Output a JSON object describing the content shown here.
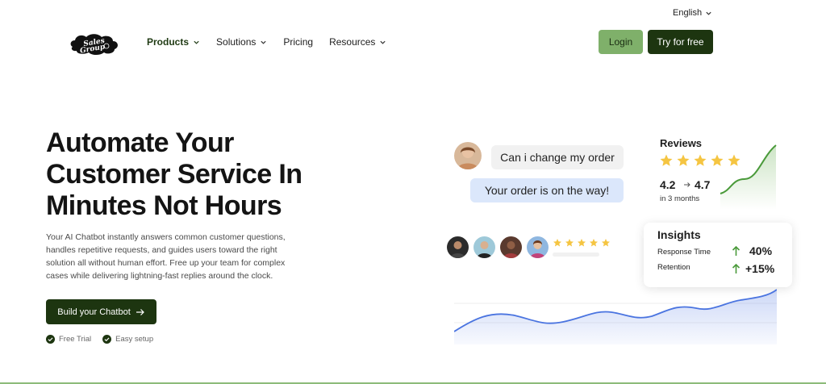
{
  "header": {
    "language": "English",
    "logo_text": "Sales Group",
    "nav": [
      {
        "label": "Products",
        "has_dropdown": true,
        "active": true
      },
      {
        "label": "Solutions",
        "has_dropdown": true,
        "active": false
      },
      {
        "label": "Pricing",
        "has_dropdown": false,
        "active": false
      },
      {
        "label": "Resources",
        "has_dropdown": true,
        "active": false
      }
    ],
    "login_label": "Login",
    "try_label": "Try for free"
  },
  "hero": {
    "title": "Automate Your Customer Service In Minutes Not Hours",
    "description": "Your AI Chatbot instantly answers common customer questions, handles repetitive requests, and guides users toward the right solution all without human effort. Free up your team for complex cases while delivering lightning-fast replies around the clock.",
    "cta_label": "Build your Chatbot",
    "checks": [
      "Free Trial",
      "Easy setup"
    ]
  },
  "chat": {
    "question": "Can i change my order",
    "answer": "Your order is on the way!"
  },
  "reviews": {
    "title": "Reviews",
    "rating_stars": 5,
    "from": "4.2",
    "to": "4.7",
    "period": "in 3 months"
  },
  "social_proof": {
    "stars": 5
  },
  "insights": {
    "title": "Insights",
    "metrics": [
      {
        "label": "Response Time",
        "value": "40%",
        "direction": "up"
      },
      {
        "label": "Retention",
        "value": "+15%",
        "direction": "up"
      }
    ]
  },
  "colors": {
    "brand_dark": "#1d3510",
    "brand_light": "#7fb06a",
    "star": "#f5c542",
    "growth_green": "#4a9a3a",
    "wave_blue": "#4a74e0"
  }
}
